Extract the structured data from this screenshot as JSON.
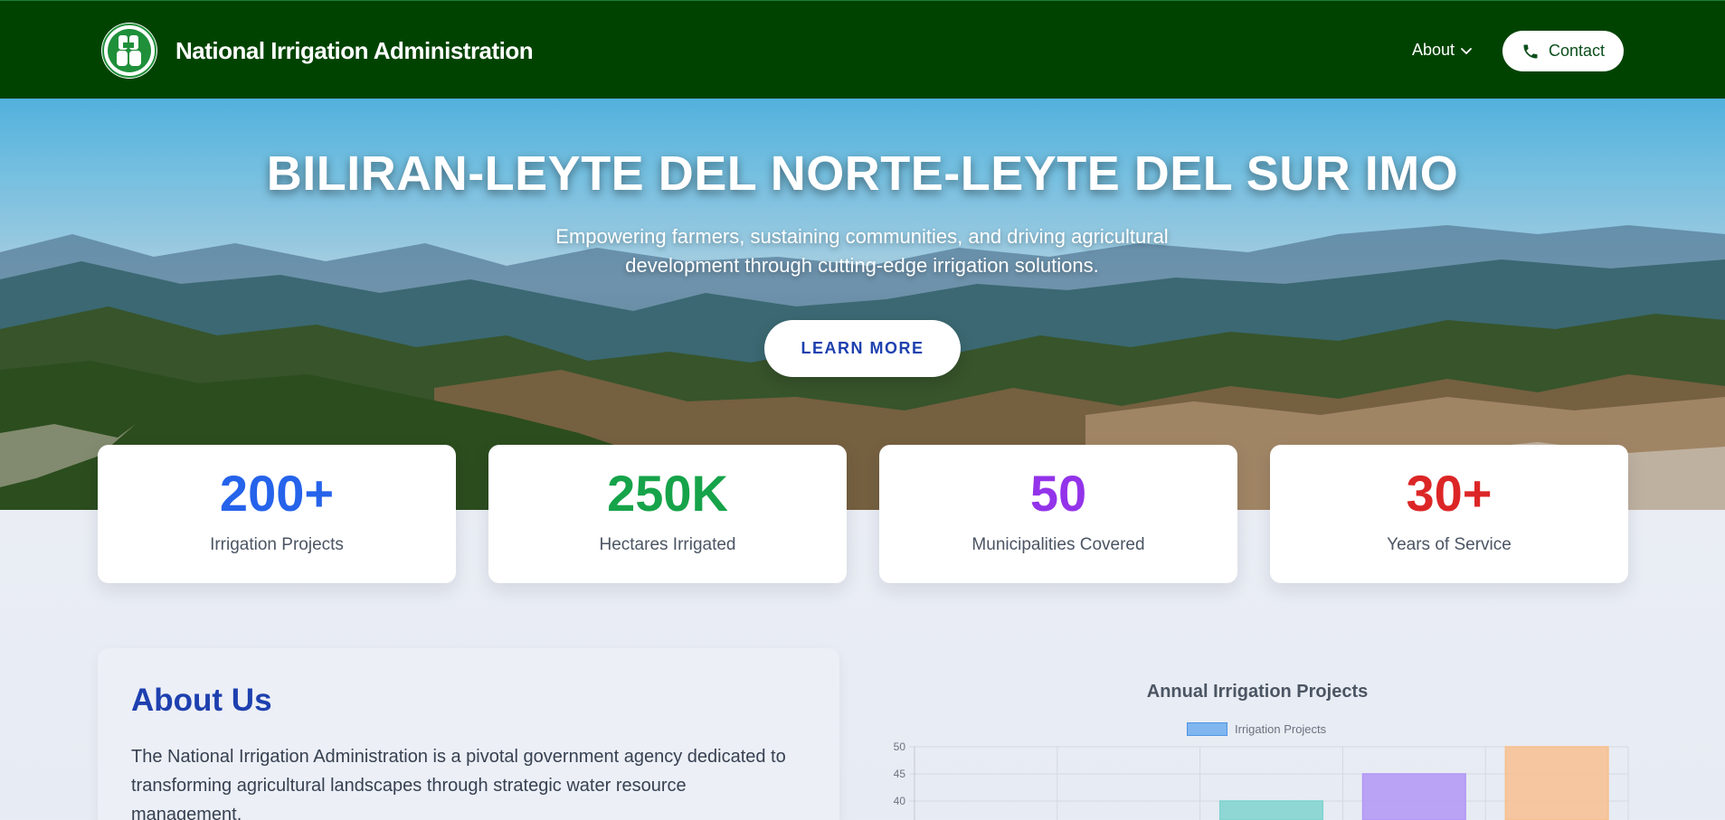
{
  "header": {
    "org_name": "National Irrigation Administration",
    "logo_icon": "nia-logo-icon",
    "nav": {
      "about_label": "About",
      "contact_label": "Contact"
    }
  },
  "hero": {
    "title": "BILIRAN-LEYTE DEL NORTE-LEYTE DEL SUR IMO",
    "subtitle": "Empowering farmers, sustaining communities, and driving agricultural development through cutting-edge irrigation solutions.",
    "cta_label": "LEARN MORE"
  },
  "stats": [
    {
      "value": "200+",
      "label": "Irrigation Projects",
      "color": "#2563eb"
    },
    {
      "value": "250K",
      "label": "Hectares Irrigated",
      "color": "#16a34a"
    },
    {
      "value": "50",
      "label": "Municipalities Covered",
      "color": "#9333ea"
    },
    {
      "value": "30+",
      "label": "Years of Service",
      "color": "#dc2626"
    }
  ],
  "about": {
    "title": "About Us",
    "text": "The National Irrigation Administration is a pivotal government agency dedicated to transforming agricultural landscapes through strategic water resource management."
  },
  "chart_data": {
    "type": "bar",
    "title": "Annual Irrigation Projects",
    "series": [
      {
        "name": "Irrigation Projects",
        "values": [
          null,
          null,
          40,
          45,
          50
        ]
      }
    ],
    "bar_colors": [
      "#7fd3cf",
      "#b197f5",
      "#f7c08f"
    ],
    "y_ticks": [
      40,
      45,
      50
    ],
    "ylim_visible": [
      38,
      50
    ],
    "legend_placement": "top",
    "grid": true
  }
}
